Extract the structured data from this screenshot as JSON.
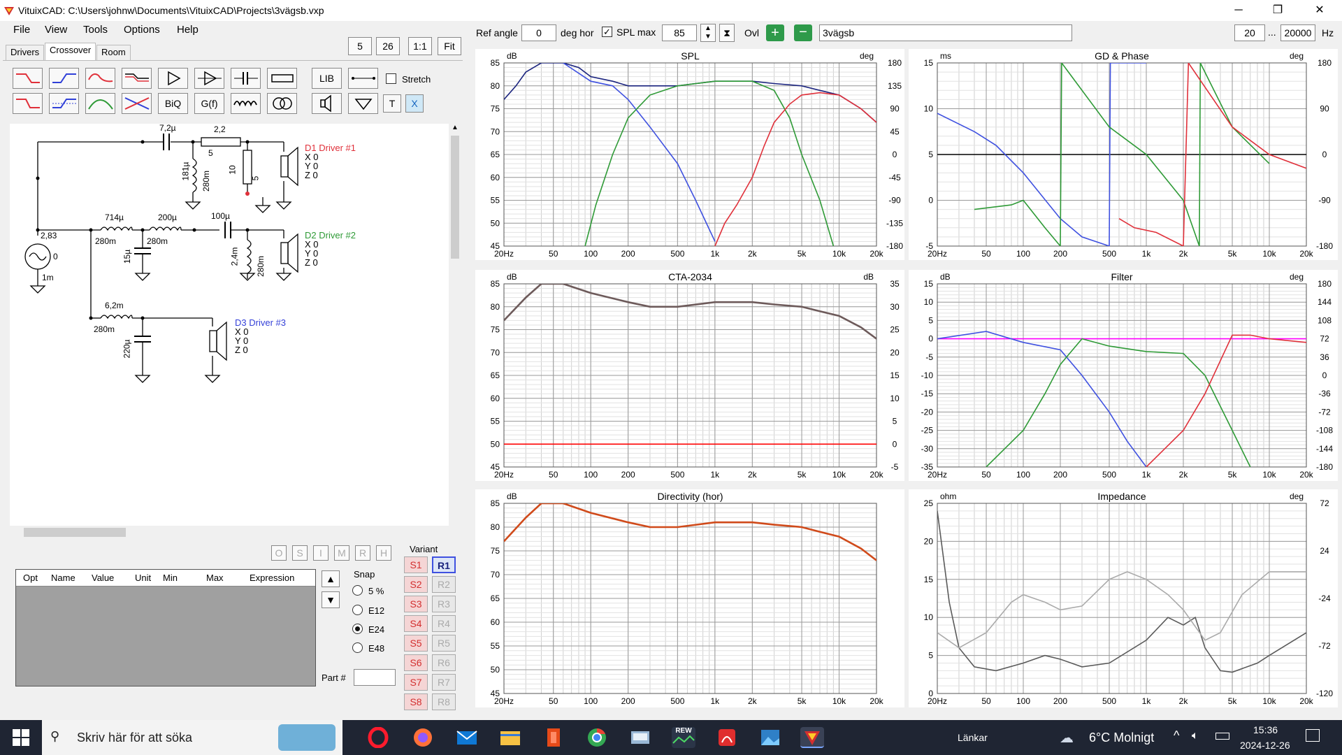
{
  "window": {
    "title": "VituixCAD: C:\\Users\\johnw\\Documents\\VituixCAD\\Projects\\3vägsb.vxp",
    "min": "─",
    "max": "❐",
    "close": "✕"
  },
  "menu": [
    "File",
    "View",
    "Tools",
    "Options",
    "Help"
  ],
  "tabs": [
    "Drivers",
    "Crossover",
    "Room"
  ],
  "zoom_buttons": [
    "5",
    "26",
    "1:1",
    "Fit"
  ],
  "toolbar": {
    "lib": "LIB",
    "biq": "BiQ",
    "gf": "G(f)",
    "t": "T",
    "x": "X",
    "stretch": "Stretch"
  },
  "schematic": {
    "labels": [
      "7,2µ",
      "2,2",
      "5",
      "181µ",
      "280m",
      "10",
      "5",
      "714µ",
      "280m",
      "200µ",
      "280m",
      "100µ",
      "15µ",
      "2,4m",
      "280m",
      "2,83",
      "0",
      "1m",
      "6,2m",
      "280m",
      "220µ"
    ],
    "drivers": [
      {
        "name": "D1 Driver #1",
        "color": "#e0303a",
        "x": "X 0",
        "y": "Y 0",
        "z": "Z 0"
      },
      {
        "name": "D2 Driver #2",
        "color": "#2e9a36",
        "x": "X 0",
        "y": "Y 0",
        "z": "Z 0"
      },
      {
        "name": "D3 Driver #3",
        "color": "#3440d8",
        "x": "X 0",
        "y": "Y 0",
        "z": "Z 0"
      }
    ]
  },
  "lock_buttons": [
    "O",
    "S",
    "I",
    "M",
    "R",
    "H"
  ],
  "table_headers": [
    "Opt",
    "Name",
    "Value",
    "Unit",
    "Min",
    "Max",
    "Expression"
  ],
  "snap": {
    "title": "Snap",
    "options": [
      "5 %",
      "E12",
      "E24",
      "E48"
    ],
    "selected": "E24"
  },
  "part_label": "Part #",
  "variant": {
    "title": "Variant",
    "s": [
      "S1",
      "S2",
      "S3",
      "S4",
      "S5",
      "S6",
      "S7",
      "S8"
    ],
    "r": [
      "R1",
      "R2",
      "R3",
      "R4",
      "R5",
      "R6",
      "R7",
      "R8"
    ]
  },
  "top_controls": {
    "ref_angle_label": "Ref angle",
    "ref_angle": "0",
    "deg_hor": "deg hor",
    "spl_max_label": "SPL max",
    "spl_max": "85",
    "ovl": "Ovl",
    "project": "3vägsb",
    "f_min": "20",
    "dots": "...",
    "f_max": "20000",
    "hz": "Hz"
  },
  "chart_data": [
    {
      "type": "line",
      "title": "SPL",
      "ylabel_left": "dB",
      "ylabel_right": "deg",
      "x_ticks": [
        "20Hz",
        "50",
        "100",
        "200",
        "500",
        "1k",
        "2k",
        "5k",
        "10k",
        "20k"
      ],
      "y_left_ticks": [
        "85",
        "80",
        "75",
        "70",
        "65",
        "60",
        "55",
        "50",
        "45"
      ],
      "y_right_ticks": [
        "180",
        "135",
        "90",
        "45",
        "0",
        "-45",
        "-90",
        "-135",
        "-180"
      ],
      "ylim": [
        45,
        85
      ],
      "series": [
        {
          "color": "#1a237e",
          "points": [
            [
              20,
              77
            ],
            [
              25,
              80
            ],
            [
              30,
              83
            ],
            [
              40,
              85
            ],
            [
              60,
              85
            ],
            [
              80,
              84
            ],
            [
              100,
              82
            ],
            [
              150,
              81
            ],
            [
              200,
              80
            ],
            [
              300,
              80
            ],
            [
              500,
              80
            ],
            [
              700,
              80.5
            ],
            [
              1000,
              81
            ],
            [
              1500,
              81
            ],
            [
              2000,
              81
            ],
            [
              3000,
              80.5
            ],
            [
              5000,
              80
            ],
            [
              7000,
              79
            ],
            [
              10000,
              78
            ],
            [
              15000,
              75
            ],
            [
              20000,
              72
            ]
          ]
        },
        {
          "color": "#3f51e0",
          "points": [
            [
              60,
              85
            ],
            [
              100,
              81
            ],
            [
              150,
              80
            ],
            [
              200,
              77
            ],
            [
              300,
              71
            ],
            [
              500,
              63
            ],
            [
              700,
              55
            ],
            [
              1000,
              46
            ]
          ]
        },
        {
          "color": "#2e9a36",
          "points": [
            [
              90,
              45
            ],
            [
              110,
              54
            ],
            [
              150,
              65
            ],
            [
              200,
              73
            ],
            [
              300,
              78
            ],
            [
              500,
              80
            ],
            [
              1000,
              81
            ],
            [
              2000,
              81
            ],
            [
              3000,
              79
            ],
            [
              4000,
              73
            ],
            [
              5000,
              65
            ],
            [
              7000,
              55
            ],
            [
              9000,
              45
            ]
          ]
        },
        {
          "color": "#e0303a",
          "points": [
            [
              1000,
              45
            ],
            [
              1200,
              50
            ],
            [
              1500,
              54
            ],
            [
              2000,
              60
            ],
            [
              2500,
              67
            ],
            [
              3000,
              72
            ],
            [
              4000,
              76
            ],
            [
              5000,
              78
            ],
            [
              7000,
              78.5
            ],
            [
              10000,
              78
            ],
            [
              15000,
              75
            ],
            [
              20000,
              72
            ]
          ]
        }
      ]
    },
    {
      "type": "line",
      "title": "GD & Phase",
      "ylabel_left": "ms",
      "ylabel_right": "deg",
      "x_ticks": [
        "20Hz",
        "50",
        "100",
        "200",
        "500",
        "1k",
        "2k",
        "5k",
        "10k",
        "20k"
      ],
      "y_left_ticks": [
        "15",
        "10",
        "5",
        "0",
        "-5"
      ],
      "y_right_ticks": [
        "180",
        "90",
        "0",
        "-90",
        "-180"
      ],
      "ylim": [
        -5,
        15
      ],
      "series": [
        {
          "color": "#000000",
          "points": [
            [
              20,
              5
            ],
            [
              20000,
              5
            ]
          ]
        },
        {
          "color": "#3f51e0",
          "points": [
            [
              20,
              9.5
            ],
            [
              40,
              7.5
            ],
            [
              60,
              6
            ],
            [
              100,
              3
            ],
            [
              200,
              -2
            ],
            [
              300,
              -4
            ],
            [
              500,
              -5
            ],
            [
              510,
              15
            ],
            [
              1000,
              15
            ]
          ]
        },
        {
          "color": "#2e9a36",
          "points": [
            [
              40,
              -1
            ],
            [
              80,
              -0.5
            ],
            [
              100,
              0
            ],
            [
              150,
              -3
            ],
            [
              200,
              -5
            ],
            [
              205,
              15
            ],
            [
              500,
              8
            ],
            [
              1000,
              5
            ],
            [
              2000,
              0
            ],
            [
              2700,
              -5
            ],
            [
              2750,
              15
            ],
            [
              5000,
              8
            ],
            [
              10000,
              4
            ]
          ]
        },
        {
          "color": "#e0303a",
          "points": [
            [
              600,
              -2
            ],
            [
              800,
              -3
            ],
            [
              1200,
              -3.5
            ],
            [
              2000,
              -5
            ],
            [
              2200,
              15
            ],
            [
              5000,
              8
            ],
            [
              10000,
              5
            ],
            [
              20000,
              3.5
            ]
          ]
        }
      ]
    },
    {
      "type": "line",
      "title": "CTA-2034",
      "ylabel_left": "dB",
      "ylabel_right": "dB",
      "x_ticks": [
        "20Hz",
        "50",
        "100",
        "200",
        "500",
        "1k",
        "2k",
        "5k",
        "10k",
        "20k"
      ],
      "y_left_ticks": [
        "85",
        "80",
        "75",
        "70",
        "65",
        "60",
        "55",
        "50",
        "45"
      ],
      "y_right_ticks": [
        "35",
        "30",
        "25",
        "20",
        "15",
        "10",
        "5",
        "0",
        "-5"
      ],
      "ylim": [
        45,
        85
      ],
      "series": [
        {
          "color": "#6d5a5a",
          "points": [
            [
              20,
              77
            ],
            [
              30,
              82
            ],
            [
              40,
              85
            ],
            [
              60,
              85
            ],
            [
              100,
              83
            ],
            [
              200,
              81
            ],
            [
              300,
              80
            ],
            [
              500,
              80
            ],
            [
              1000,
              81
            ],
            [
              2000,
              81
            ],
            [
              3000,
              80.5
            ],
            [
              5000,
              80
            ],
            [
              7000,
              79
            ],
            [
              10000,
              78
            ],
            [
              15000,
              75.5
            ],
            [
              20000,
              73
            ]
          ]
        },
        {
          "color": "#ff0000",
          "points": [
            [
              20,
              50
            ],
            [
              20000,
              50
            ]
          ]
        }
      ]
    },
    {
      "type": "line",
      "title": "Filter",
      "ylabel_left": "dB",
      "ylabel_right": "deg",
      "x_ticks": [
        "20Hz",
        "50",
        "100",
        "200",
        "500",
        "1k",
        "2k",
        "5k",
        "10k",
        "20k"
      ],
      "y_left_ticks": [
        "15",
        "10",
        "5",
        "0",
        "-5",
        "-10",
        "-15",
        "-20",
        "-25",
        "-30",
        "-35"
      ],
      "y_right_ticks": [
        "180",
        "144",
        "108",
        "72",
        "36",
        "0",
        "-36",
        "-72",
        "-108",
        "-144",
        "-180"
      ],
      "ylim": [
        -35,
        15
      ],
      "series": [
        {
          "color": "#ff00ff",
          "points": [
            [
              20,
              0
            ],
            [
              20000,
              0
            ]
          ]
        },
        {
          "color": "#3f51e0",
          "points": [
            [
              20,
              0
            ],
            [
              50,
              2
            ],
            [
              100,
              -1
            ],
            [
              200,
              -3
            ],
            [
              300,
              -10
            ],
            [
              500,
              -20
            ],
            [
              700,
              -28
            ],
            [
              1000,
              -35
            ]
          ]
        },
        {
          "color": "#2e9a36",
          "points": [
            [
              50,
              -35
            ],
            [
              100,
              -25
            ],
            [
              150,
              -15
            ],
            [
              200,
              -7
            ],
            [
              300,
              0
            ],
            [
              500,
              -2
            ],
            [
              1000,
              -3.5
            ],
            [
              2000,
              -4
            ],
            [
              3000,
              -10
            ],
            [
              5000,
              -25
            ],
            [
              7000,
              -35
            ]
          ]
        },
        {
          "color": "#e0303a",
          "points": [
            [
              1000,
              -35
            ],
            [
              2000,
              -25
            ],
            [
              3000,
              -15
            ],
            [
              5000,
              1
            ],
            [
              7000,
              1
            ],
            [
              10000,
              0
            ],
            [
              20000,
              -1
            ]
          ]
        }
      ]
    },
    {
      "type": "line",
      "title": "Directivity (hor)",
      "ylabel_left": "dB",
      "x_ticks": [
        "20Hz",
        "50",
        "100",
        "200",
        "500",
        "1k",
        "2k",
        "5k",
        "10k",
        "20k"
      ],
      "y_left_ticks": [
        "85",
        "80",
        "75",
        "70",
        "65",
        "60",
        "55",
        "50",
        "45"
      ],
      "ylim": [
        45,
        85
      ],
      "series": [
        {
          "color": "#d04a1a",
          "points": [
            [
              20,
              77
            ],
            [
              30,
              82
            ],
            [
              40,
              85
            ],
            [
              60,
              85
            ],
            [
              100,
              83
            ],
            [
              200,
              81
            ],
            [
              300,
              80
            ],
            [
              500,
              80
            ],
            [
              1000,
              81
            ],
            [
              2000,
              81
            ],
            [
              3000,
              80.5
            ],
            [
              5000,
              80
            ],
            [
              7000,
              79
            ],
            [
              10000,
              78
            ],
            [
              15000,
              75.5
            ],
            [
              20000,
              73
            ]
          ]
        }
      ]
    },
    {
      "type": "line",
      "title": "Impedance",
      "ylabel_left": "ohm",
      "ylabel_right": "deg",
      "x_ticks": [
        "20Hz",
        "50",
        "100",
        "200",
        "500",
        "1k",
        "2k",
        "5k",
        "10k",
        "20k"
      ],
      "y_left_ticks": [
        "25",
        "20",
        "15",
        "10",
        "5",
        "0"
      ],
      "y_right_ticks": [
        "72",
        "24",
        "-24",
        "-72",
        "-120"
      ],
      "ylim": [
        0,
        25
      ],
      "series": [
        {
          "color": "#5a5a5a",
          "points": [
            [
              20,
              24
            ],
            [
              25,
              12
            ],
            [
              30,
              6
            ],
            [
              40,
              3.5
            ],
            [
              60,
              3
            ],
            [
              100,
              4
            ],
            [
              150,
              5
            ],
            [
              200,
              4.5
            ],
            [
              300,
              3.5
            ],
            [
              500,
              4
            ],
            [
              1000,
              7
            ],
            [
              1500,
              10
            ],
            [
              2000,
              9
            ],
            [
              2500,
              10
            ],
            [
              3000,
              6
            ],
            [
              4000,
              3
            ],
            [
              5000,
              2.8
            ],
            [
              8000,
              4
            ],
            [
              10000,
              5
            ],
            [
              20000,
              8
            ]
          ]
        },
        {
          "color": "#aaaaaa",
          "points": [
            [
              20,
              8
            ],
            [
              30,
              6
            ],
            [
              50,
              8
            ],
            [
              80,
              12
            ],
            [
              100,
              13
            ],
            [
              150,
              12
            ],
            [
              200,
              11
            ],
            [
              300,
              11.5
            ],
            [
              500,
              15
            ],
            [
              700,
              16
            ],
            [
              1000,
              15
            ],
            [
              1500,
              13
            ],
            [
              2000,
              11
            ],
            [
              3000,
              7
            ],
            [
              4000,
              8
            ],
            [
              6000,
              13
            ],
            [
              10000,
              16
            ],
            [
              20000,
              16
            ]
          ]
        }
      ]
    }
  ],
  "taskbar": {
    "search": "Skriv här för att söka",
    "links": "Länkar",
    "weather": "6°C Molnigt",
    "time": "15:36",
    "date": "2024-12-26",
    "rew": "REW"
  }
}
